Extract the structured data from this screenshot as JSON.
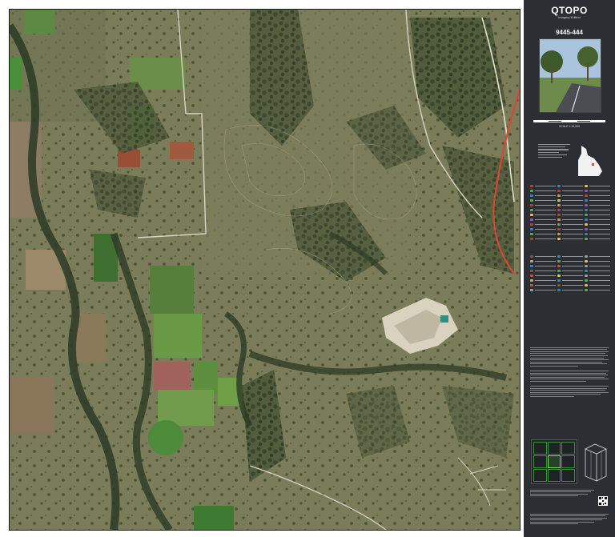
{
  "panel": {
    "title": "QTOPO",
    "subtitle": "Imagery Edition",
    "sheet_number": "9445-444",
    "scale": "SCALE 1:15,000"
  },
  "icons": [
    "queensland-outline-icon",
    "qr-code-icon"
  ],
  "colors": {
    "panel_bg": "#2b2f33",
    "road": "#d8473a",
    "index_highlight": "#7ddc5b"
  }
}
